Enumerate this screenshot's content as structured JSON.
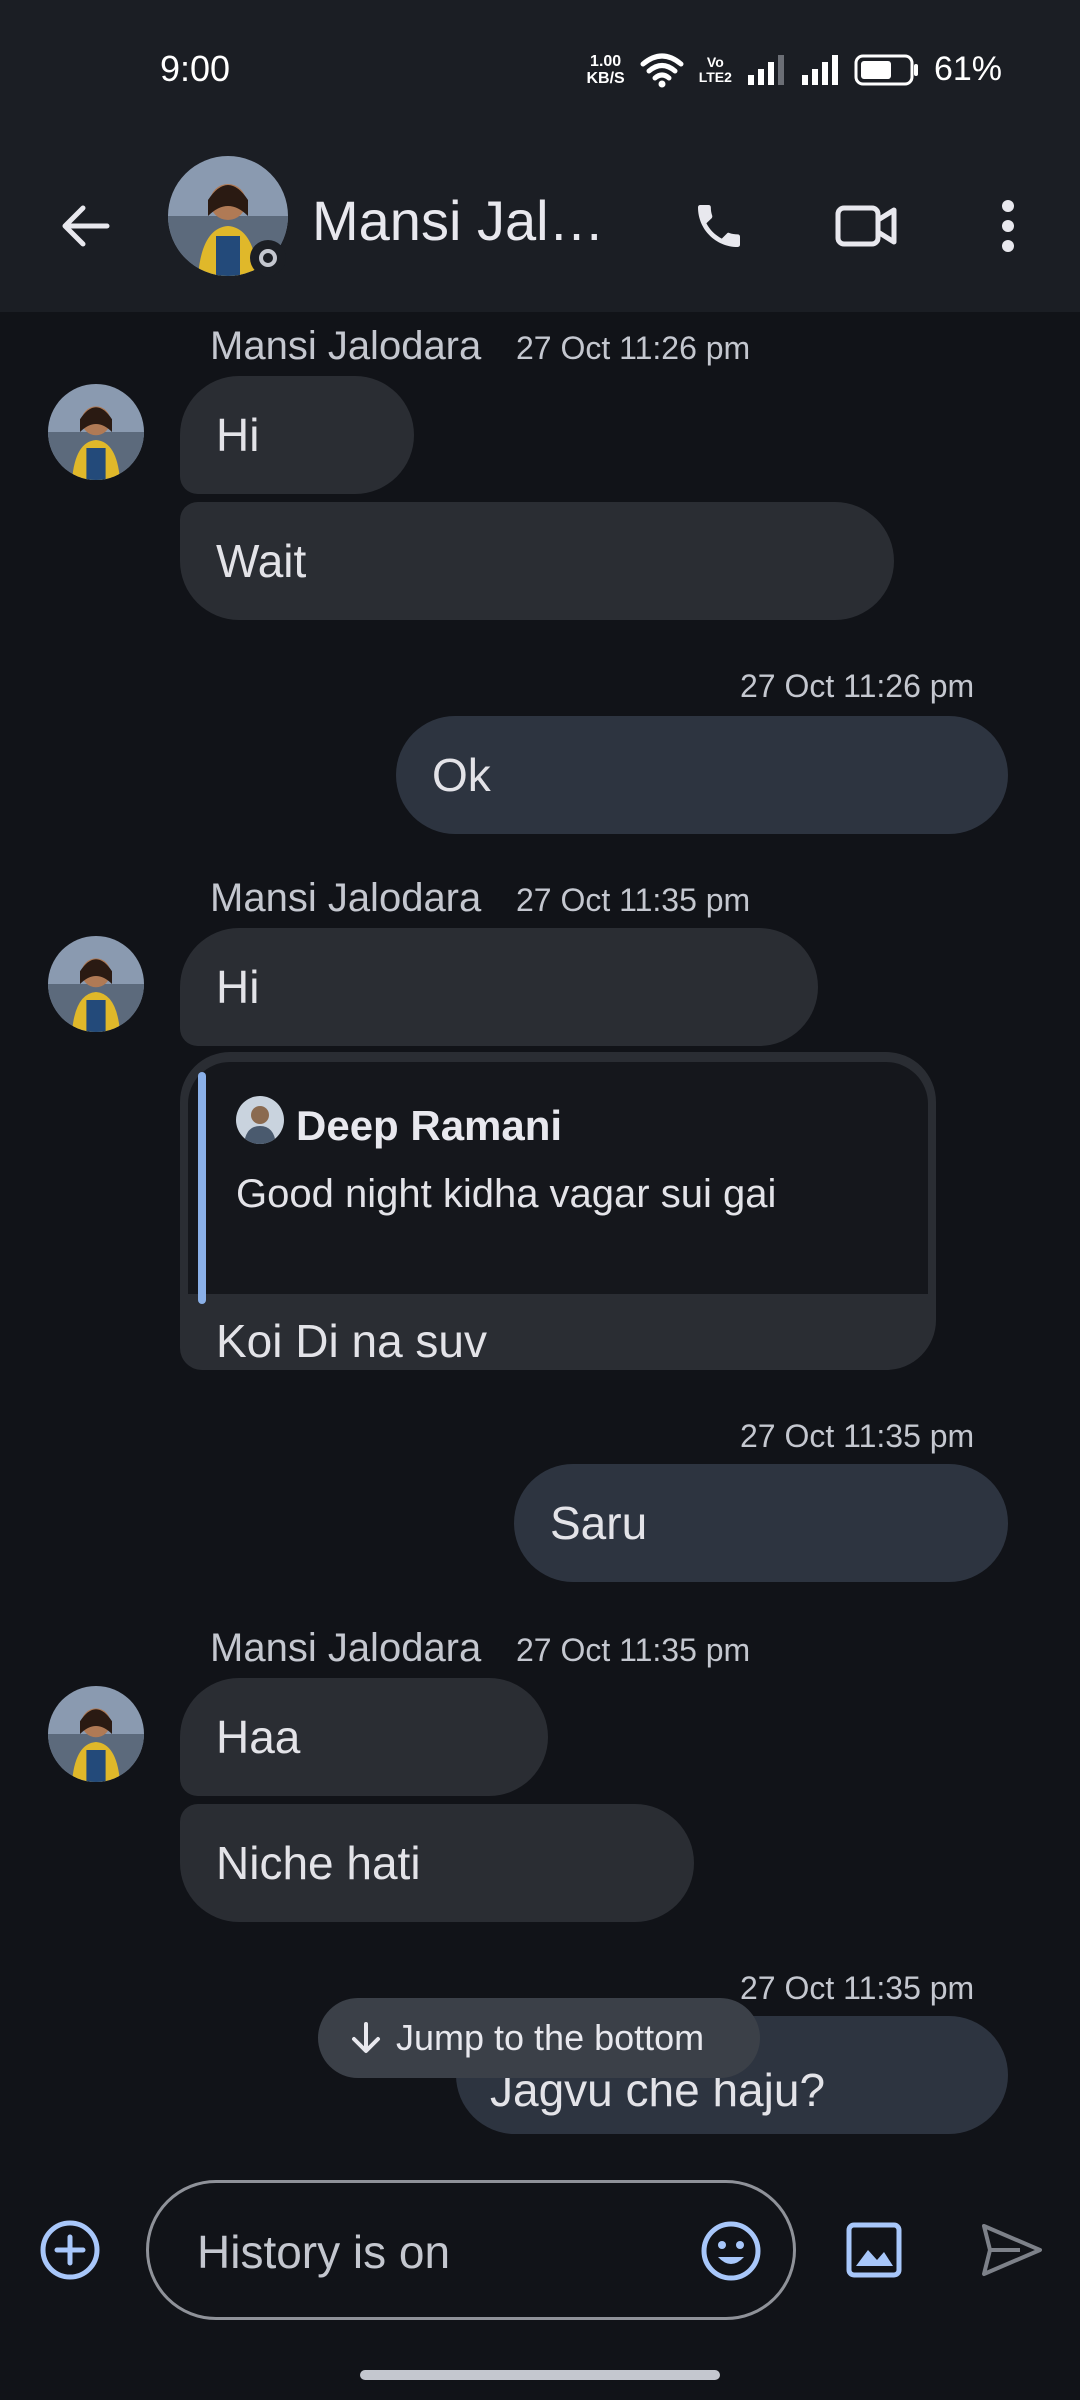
{
  "status_bar": {
    "time": "9:00",
    "speed_value": "1.00",
    "speed_unit": "KB/S",
    "vo_top": "Vo",
    "vo_bottom": "LTE2",
    "battery": "61%",
    "icons": [
      "wifi-icon",
      "signal-icon",
      "signal-icon",
      "battery-icon"
    ]
  },
  "header": {
    "back_icon": "arrow-left-icon",
    "title": "Mansi Jalo…",
    "call_icon": "phone-icon",
    "video_icon": "video-call-icon",
    "more_icon": "more-vert-icon"
  },
  "messages": {
    "g1": {
      "sender": "Mansi Jalodara",
      "time": "27 Oct 11:26 pm",
      "b1": "Hi",
      "b2": "Wait"
    },
    "o1": {
      "time": "27 Oct 11:26 pm",
      "text": "Ok"
    },
    "g2": {
      "sender": "Mansi Jalodara",
      "time": "27 Oct 11:35 pm",
      "b1": "Hi",
      "quote_author": "Deep Ramani",
      "quote_text": "Good night kidha vagar sui gai",
      "reply": "Koi Di na suv"
    },
    "o2": {
      "time": "27 Oct 11:35 pm",
      "text": "Saru"
    },
    "g3": {
      "sender": "Mansi Jalodara",
      "time": "27 Oct 11:35 pm",
      "b1": "Haa",
      "b2": "Niche hati"
    },
    "o3": {
      "time": "27 Oct 11:35 pm",
      "text": "Jagvu che haju?"
    }
  },
  "jump_label": "Jump to the bottom",
  "composer": {
    "placeholder": "History is on",
    "add_icon": "add-circle-icon",
    "emoji_icon": "emoji-icon",
    "gallery_icon": "image-icon",
    "send_icon": "send-icon"
  },
  "colors": {
    "background": "#111318",
    "incoming_bubble": "#2a2d33",
    "outgoing_bubble": "#2d3440",
    "accent": "#a8c7fa"
  }
}
